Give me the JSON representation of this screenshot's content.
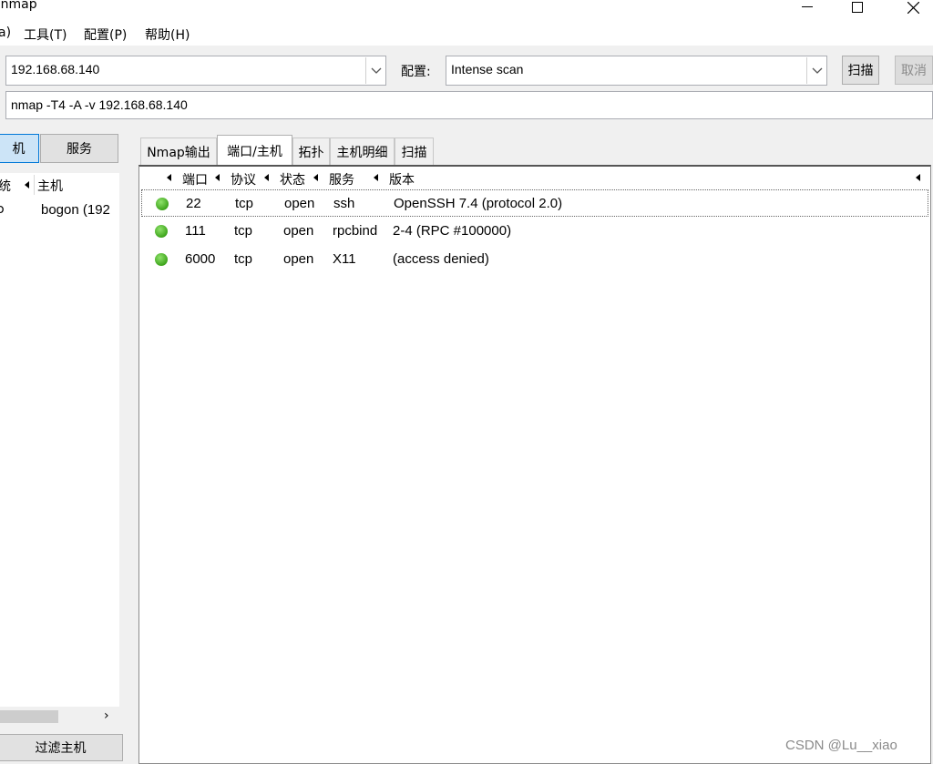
{
  "window": {
    "title": "enmap"
  },
  "menu": {
    "items": [
      {
        "label": "a)"
      },
      {
        "label": "工具(T)"
      },
      {
        "label": "配置(P)"
      },
      {
        "label": "帮助(H)"
      }
    ]
  },
  "toolbar": {
    "target_value": "192.168.68.140",
    "profile_label": "配置:",
    "profile_value": "Intense scan",
    "scan_label": "扫描",
    "cancel_label": "取消",
    "command_value": "nmap -T4 -A -v 192.168.68.140"
  },
  "left_panel": {
    "hosts_button": "机",
    "services_button": "服务",
    "col_os": "统",
    "col_host": "主机",
    "hosts": [
      {
        "name": "bogon (192"
      }
    ],
    "filter_button": "过滤主机"
  },
  "tabs": [
    {
      "label": "Nmap输出"
    },
    {
      "label": "端口/主机"
    },
    {
      "label": "拓扑"
    },
    {
      "label": "主机明细"
    },
    {
      "label": "扫描"
    }
  ],
  "ports_table": {
    "columns": [
      "端口",
      "协议",
      "状态",
      "服务",
      "版本"
    ],
    "rows": [
      {
        "port": "22",
        "protocol": "tcp",
        "state": "open",
        "service": "ssh",
        "version": "OpenSSH 7.4 (protocol 2.0)"
      },
      {
        "port": "111",
        "protocol": "tcp",
        "state": "open",
        "service": "rpcbind",
        "version": "2-4 (RPC #100000)"
      },
      {
        "port": "6000",
        "protocol": "tcp",
        "state": "open",
        "service": "X11",
        "version": "(access denied)"
      }
    ]
  },
  "watermark": "CSDN @Lu__xiao",
  "colors": {
    "status_open": "#3ea51c",
    "selection_tab": "#cce4f7"
  }
}
